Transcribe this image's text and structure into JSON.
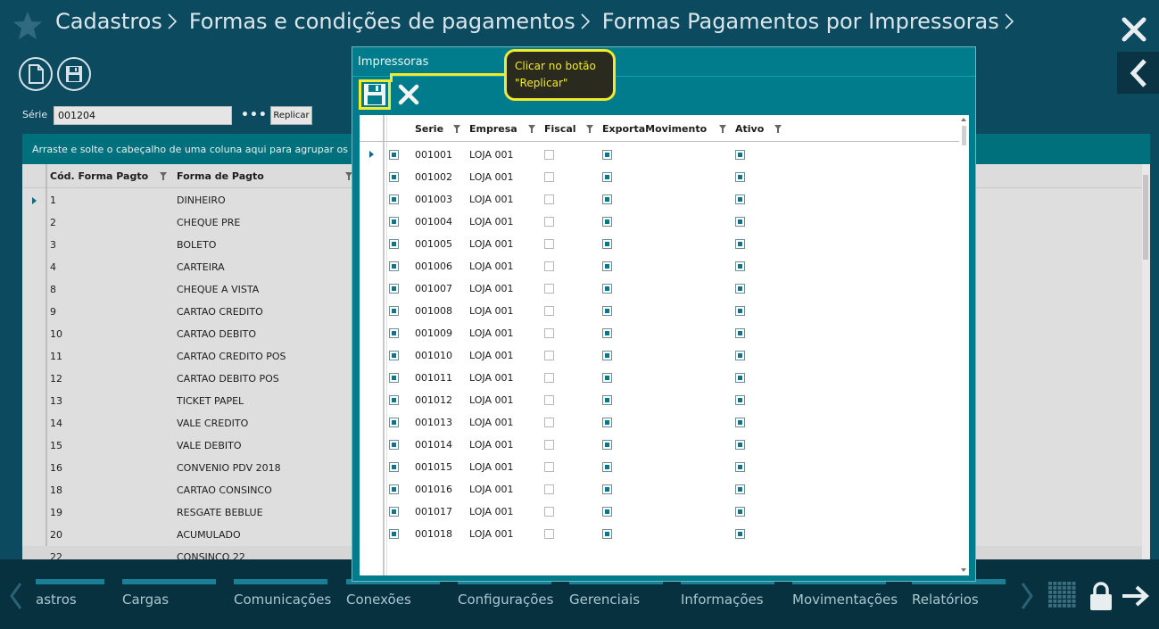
{
  "header": {
    "breadcrumb": [
      "Cadastros",
      "Formas e condições de pagamentos",
      "Formas Pagamentos por Impressoras"
    ]
  },
  "toolbar": {
    "serie_label": "Série",
    "serie_value": "001204",
    "more_label": "•••",
    "replicar_label": "Replicar"
  },
  "background_grid": {
    "group_hint": "Arraste e solte o cabeçalho de uma coluna aqui para agrupar os dados",
    "columns": [
      "Cód. Forma Pagto",
      "Forma de Pagto"
    ],
    "rows": [
      [
        "1",
        "DINHEIRO"
      ],
      [
        "2",
        "CHEQUE PRE"
      ],
      [
        "3",
        "BOLETO"
      ],
      [
        "4",
        "CARTEIRA"
      ],
      [
        "8",
        "CHEQUE A VISTA"
      ],
      [
        "9",
        "CARTAO CREDITO"
      ],
      [
        "10",
        "CARTAO DEBITO"
      ],
      [
        "11",
        "CARTAO CREDITO POS"
      ],
      [
        "12",
        "CARTAO DEBITO POS"
      ],
      [
        "13",
        "TICKET PAPEL"
      ],
      [
        "14",
        "VALE CREDITO"
      ],
      [
        "15",
        "VALE DEBITO"
      ],
      [
        "16",
        "CONVENIO PDV 2018"
      ],
      [
        "18",
        "CARTAO CONSINCO"
      ],
      [
        "19",
        "RESGATE BEBLUE"
      ],
      [
        "20",
        "ACUMULADO"
      ],
      [
        "22",
        "CONSINCO 22"
      ]
    ]
  },
  "modal": {
    "title": "Impressoras",
    "columns": [
      "Serie",
      "Empresa",
      "Fiscal",
      "ExportaMovimento",
      "Ativo"
    ],
    "rows": [
      {
        "serie": "001001",
        "empresa": "LOJA 001",
        "fiscal": false,
        "exporta": true,
        "ativo": true
      },
      {
        "serie": "001002",
        "empresa": "LOJA 001",
        "fiscal": false,
        "exporta": true,
        "ativo": true
      },
      {
        "serie": "001003",
        "empresa": "LOJA 001",
        "fiscal": false,
        "exporta": true,
        "ativo": true
      },
      {
        "serie": "001004",
        "empresa": "LOJA 001",
        "fiscal": false,
        "exporta": true,
        "ativo": true
      },
      {
        "serie": "001005",
        "empresa": "LOJA 001",
        "fiscal": false,
        "exporta": true,
        "ativo": true
      },
      {
        "serie": "001006",
        "empresa": "LOJA 001",
        "fiscal": false,
        "exporta": true,
        "ativo": true
      },
      {
        "serie": "001007",
        "empresa": "LOJA 001",
        "fiscal": false,
        "exporta": true,
        "ativo": true
      },
      {
        "serie": "001008",
        "empresa": "LOJA 001",
        "fiscal": false,
        "exporta": true,
        "ativo": true
      },
      {
        "serie": "001009",
        "empresa": "LOJA 001",
        "fiscal": false,
        "exporta": true,
        "ativo": true
      },
      {
        "serie": "001010",
        "empresa": "LOJA 001",
        "fiscal": false,
        "exporta": true,
        "ativo": true
      },
      {
        "serie": "001011",
        "empresa": "LOJA 001",
        "fiscal": false,
        "exporta": true,
        "ativo": true
      },
      {
        "serie": "001012",
        "empresa": "LOJA 001",
        "fiscal": false,
        "exporta": true,
        "ativo": true
      },
      {
        "serie": "001013",
        "empresa": "LOJA 001",
        "fiscal": false,
        "exporta": true,
        "ativo": true
      },
      {
        "serie": "001014",
        "empresa": "LOJA 001",
        "fiscal": false,
        "exporta": true,
        "ativo": true
      },
      {
        "serie": "001015",
        "empresa": "LOJA 001",
        "fiscal": false,
        "exporta": true,
        "ativo": true
      },
      {
        "serie": "001016",
        "empresa": "LOJA 001",
        "fiscal": false,
        "exporta": true,
        "ativo": true
      },
      {
        "serie": "001017",
        "empresa": "LOJA 001",
        "fiscal": false,
        "exporta": true,
        "ativo": true
      },
      {
        "serie": "001018",
        "empresa": "LOJA 001",
        "fiscal": false,
        "exporta": true,
        "ativo": true
      }
    ]
  },
  "callout": {
    "line1": "Clicar no botão",
    "line2": "\"Replicar\""
  },
  "bottom_nav": {
    "items": [
      "astros",
      "Cargas",
      "Comunicações",
      "Conexões",
      "Configurações",
      "Gerenciais",
      "Informações",
      "Movimentações",
      "Relatórios"
    ]
  },
  "icons": {
    "star": "star-icon",
    "close": "close-icon",
    "back": "chevron-left-icon",
    "new": "new-document-icon",
    "save": "save-icon",
    "filter": "filter-icon",
    "grid": "apps-grid-icon",
    "lock": "lock-icon",
    "exit": "arrow-right-icon"
  },
  "colors": {
    "background": "#0c4a60",
    "accent_teal": "#007c8c",
    "highlight_yellow": "#f2ea2a",
    "nav_bar": "#1b7f95"
  }
}
